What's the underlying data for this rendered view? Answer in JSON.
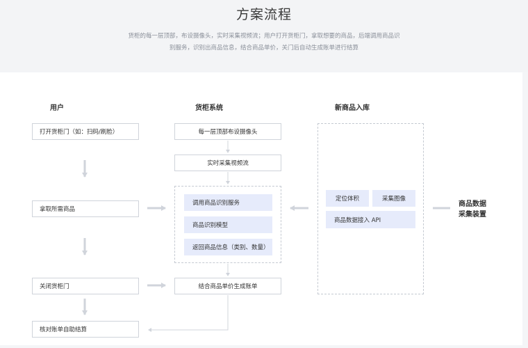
{
  "header": {
    "title": "方案流程",
    "desc_line1": "货柜的每一层顶部，布设摄像头，实时采集视频流；用户打开货柜门，拿取想要的商品，后端调用商品识",
    "desc_line2": "别服务，识别出商品信息，结合商品单价，关门后自动生成账单进行结算"
  },
  "columns": {
    "user": "用户",
    "cabinet": "货柜系统",
    "inbound": "新商品入库"
  },
  "user_steps": [
    "打开货柜门（如：扫码/刷脸）",
    "拿取所需商品",
    "关闭货柜门",
    "核对账单自助结算"
  ],
  "cabinet_steps": {
    "camera": "每一层顶部布设摄像头",
    "stream": "实时采集视频流",
    "service": "调用商品识别服务",
    "model": "商品识别模型",
    "result": "返回商品信息（类别、数量）",
    "bill": "结合商品单价生成账单"
  },
  "inbound_items": {
    "locate": "定位体积",
    "capture": "采集图像",
    "api": "商品数据接入 API"
  },
  "device": {
    "line1": "商品数据",
    "line2": "采集装置"
  }
}
